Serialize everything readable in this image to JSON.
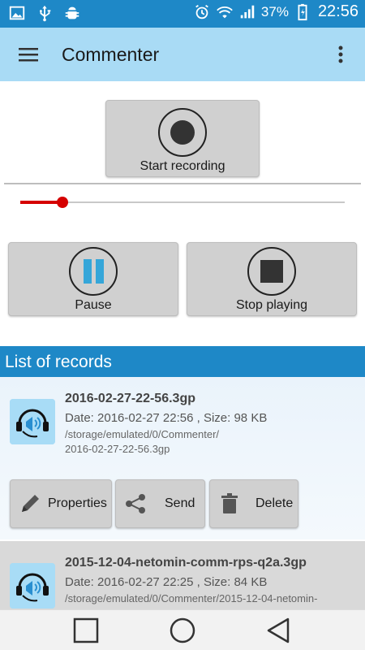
{
  "status_bar": {
    "battery": "37%",
    "time": "22:56",
    "icons": [
      "image-icon",
      "usb-icon",
      "android-debug-icon",
      "alarm-icon",
      "wifi-icon",
      "signal-icon",
      "battery-charging-icon"
    ]
  },
  "app_bar": {
    "title": "Commenter",
    "menu_icon": "hamburger-menu-icon",
    "overflow_icon": "more-vert-icon"
  },
  "controls": {
    "start_recording_label": "Start recording",
    "pause_label": "Pause",
    "stop_label": "Stop playing",
    "playback_progress": 0.13
  },
  "list": {
    "header": "List of records",
    "records": [
      {
        "title": "2016-02-27-22-56.3gp",
        "info": "Date: 2016-02-27 22:56 , Size: 98 KB",
        "path": "/storage/emulated/0/Commenter/\n2016-02-27-22-56.3gp"
      },
      {
        "title": "2015-12-04-netomin-comm-rps-q2a.3gp",
        "info": "Date: 2016-02-27 22:25 , Size: 84 KB",
        "path": "/storage/emulated/0/Commenter/2015-12-04-netomin-"
      }
    ],
    "actions": {
      "properties": "Properties",
      "send": "Send",
      "delete": "Delete"
    }
  },
  "colors": {
    "status_bar": "#1e88c7",
    "app_bar": "#a9dbf5",
    "accent_red": "#d50000",
    "pause_blue": "#35a6d9"
  }
}
